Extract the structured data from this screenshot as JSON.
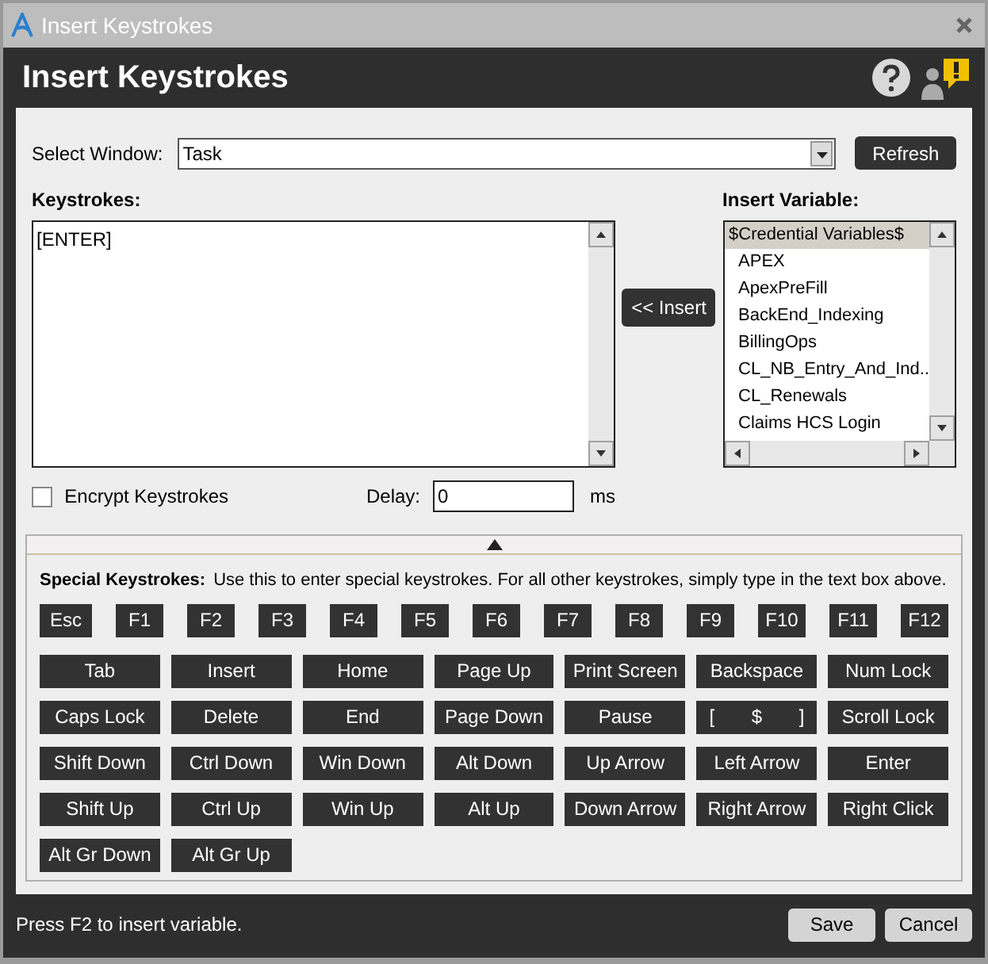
{
  "window": {
    "title": "Insert Keystrokes"
  },
  "header": {
    "title": "Insert Keystrokes"
  },
  "select_window": {
    "label": "Select Window:",
    "value": "Task"
  },
  "refresh_button": "Refresh",
  "keystrokes": {
    "label": "Keystrokes:",
    "value": "[ENTER]"
  },
  "insert_button": "<< Insert",
  "insert_variable": {
    "label": "Insert Variable:",
    "items": [
      {
        "text": "$Credential Variables$",
        "selected": true
      },
      {
        "text": "APEX",
        "selected": false
      },
      {
        "text": "ApexPreFill",
        "selected": false
      },
      {
        "text": "BackEnd_Indexing",
        "selected": false
      },
      {
        "text": "BillingOps",
        "selected": false
      },
      {
        "text": "CL_NB_Entry_And_Ind..",
        "selected": false
      },
      {
        "text": "CL_Renewals",
        "selected": false
      },
      {
        "text": "Claims HCS Login",
        "selected": false
      }
    ]
  },
  "encrypt": {
    "label": "Encrypt Keystrokes",
    "checked": false
  },
  "delay": {
    "label": "Delay:",
    "value": "0",
    "unit": "ms"
  },
  "special_keystrokes": {
    "label": "Special Keystrokes:",
    "hint": "Use this to enter special keystrokes. For all other keystrokes, simply type in the text box above.",
    "function_keys": [
      "Esc",
      "F1",
      "F2",
      "F3",
      "F4",
      "F5",
      "F6",
      "F7",
      "F8",
      "F9",
      "F10",
      "F11",
      "F12"
    ],
    "keys": [
      "Tab",
      "Insert",
      "Home",
      "Page Up",
      "Print Screen",
      "Backspace",
      "Num Lock",
      "Caps Lock",
      "Delete",
      "End",
      "Page Down",
      "Pause",
      "[       $       ]",
      "Scroll Lock",
      "Shift Down",
      "Ctrl Down",
      "Win Down",
      "Alt Down",
      "Up Arrow",
      "Left Arrow",
      "Enter",
      "Shift Up",
      "Ctrl Up",
      "Win Up",
      "Alt Up",
      "Down Arrow",
      "Right Arrow",
      "Right Click",
      "Alt Gr Down",
      "Alt Gr Up"
    ]
  },
  "status_bar": {
    "text": "Press F2 to insert variable."
  },
  "buttons": [
    "Save",
    "Cancel"
  ]
}
